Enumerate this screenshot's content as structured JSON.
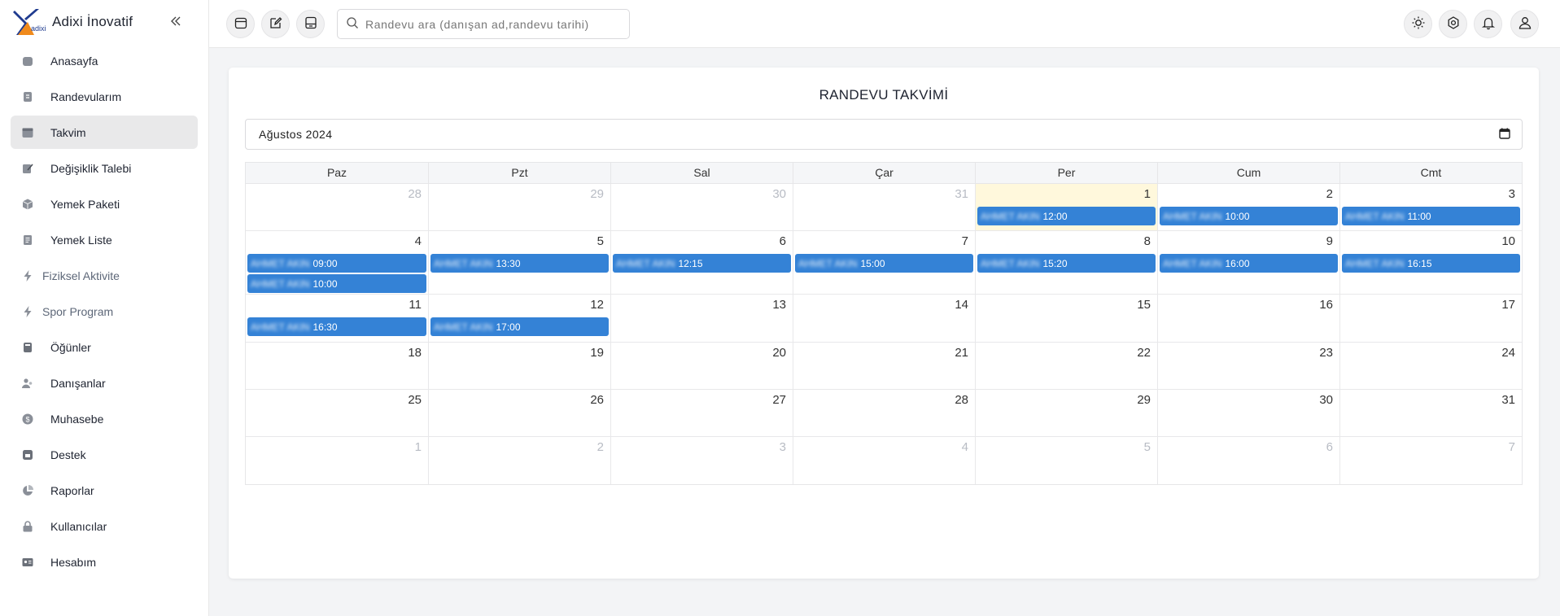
{
  "brand": {
    "title": "Adixi İnovatif",
    "logo_text": "adixi"
  },
  "sidebar": {
    "items": [
      {
        "label": "Anasayfa",
        "icon": "home-icon",
        "active": false,
        "muted": false
      },
      {
        "label": "Randevularım",
        "icon": "appointment-icon",
        "active": false,
        "muted": false
      },
      {
        "label": "Takvim",
        "icon": "calendar-icon",
        "active": true,
        "muted": false
      },
      {
        "label": "Değişiklik Talebi",
        "icon": "edit-icon",
        "active": false,
        "muted": false
      },
      {
        "label": "Yemek Paketi",
        "icon": "package-icon",
        "active": false,
        "muted": false
      },
      {
        "label": "Yemek Liste",
        "icon": "list-icon",
        "active": false,
        "muted": false
      },
      {
        "label": "Fiziksel Aktivite",
        "icon": "bolt-icon",
        "active": false,
        "muted": true
      },
      {
        "label": "Spor Program",
        "icon": "bolt-icon",
        "active": false,
        "muted": true
      },
      {
        "label": "Öğünler",
        "icon": "meals-icon",
        "active": false,
        "muted": false
      },
      {
        "label": "Danışanlar",
        "icon": "users-icon",
        "active": false,
        "muted": false
      },
      {
        "label": "Muhasebe",
        "icon": "dollar-icon",
        "active": false,
        "muted": false
      },
      {
        "label": "Destek",
        "icon": "support-icon",
        "active": false,
        "muted": false
      },
      {
        "label": "Raporlar",
        "icon": "pie-chart-icon",
        "active": false,
        "muted": false
      },
      {
        "label": "Kullanıcılar",
        "icon": "lock-icon",
        "active": false,
        "muted": false
      },
      {
        "label": "Hesabım",
        "icon": "id-card-icon",
        "active": false,
        "muted": false
      }
    ]
  },
  "search": {
    "placeholder": "Randevu ara (danışan ad,randevu tarihi)"
  },
  "calendar": {
    "title": "RANDEVU TAKVİMİ",
    "month_value": "Ağustos 2024",
    "weekdays": [
      "Paz",
      "Pzt",
      "Sal",
      "Çar",
      "Per",
      "Cum",
      "Cmt"
    ],
    "weeks": [
      [
        {
          "day": "28",
          "other": true,
          "events": []
        },
        {
          "day": "29",
          "other": true,
          "events": []
        },
        {
          "day": "30",
          "other": true,
          "events": []
        },
        {
          "day": "31",
          "other": true,
          "events": []
        },
        {
          "day": "1",
          "today": true,
          "events": [
            {
              "name": "AHMET AKIN",
              "time": "12:00"
            }
          ]
        },
        {
          "day": "2",
          "events": [
            {
              "name": "AHMET AKIN",
              "time": "10:00"
            }
          ]
        },
        {
          "day": "3",
          "events": [
            {
              "name": "AHMET AKIN",
              "time": "11:00"
            }
          ]
        }
      ],
      [
        {
          "day": "4",
          "events": [
            {
              "name": "AHMET AKIN",
              "time": "09:00"
            },
            {
              "name": "AHMET AKIN",
              "time": "10:00"
            }
          ]
        },
        {
          "day": "5",
          "events": [
            {
              "name": "AHMET AKIN",
              "time": "13:30"
            }
          ]
        },
        {
          "day": "6",
          "events": [
            {
              "name": "AHMET AKIN",
              "time": "12:15"
            }
          ]
        },
        {
          "day": "7",
          "events": [
            {
              "name": "AHMET AKIN",
              "time": "15:00"
            }
          ]
        },
        {
          "day": "8",
          "events": [
            {
              "name": "AHMET AKIN",
              "time": "15:20"
            }
          ]
        },
        {
          "day": "9",
          "events": [
            {
              "name": "AHMET AKIN",
              "time": "16:00"
            }
          ]
        },
        {
          "day": "10",
          "events": [
            {
              "name": "AHMET AKIN",
              "time": "16:15"
            }
          ]
        }
      ],
      [
        {
          "day": "11",
          "events": [
            {
              "name": "AHMET AKIN",
              "time": "16:30"
            }
          ]
        },
        {
          "day": "12",
          "events": [
            {
              "name": "AHMET AKIN",
              "time": "17:00"
            }
          ]
        },
        {
          "day": "13",
          "events": []
        },
        {
          "day": "14",
          "events": []
        },
        {
          "day": "15",
          "events": []
        },
        {
          "day": "16",
          "events": []
        },
        {
          "day": "17",
          "events": []
        }
      ],
      [
        {
          "day": "18",
          "events": []
        },
        {
          "day": "19",
          "events": []
        },
        {
          "day": "20",
          "events": []
        },
        {
          "day": "21",
          "events": []
        },
        {
          "day": "22",
          "events": []
        },
        {
          "day": "23",
          "events": []
        },
        {
          "day": "24",
          "events": []
        }
      ],
      [
        {
          "day": "25",
          "events": []
        },
        {
          "day": "26",
          "events": []
        },
        {
          "day": "27",
          "events": []
        },
        {
          "day": "28",
          "events": []
        },
        {
          "day": "29",
          "events": []
        },
        {
          "day": "30",
          "events": []
        },
        {
          "day": "31",
          "events": []
        }
      ],
      [
        {
          "day": "1",
          "other": true,
          "events": []
        },
        {
          "day": "2",
          "other": true,
          "events": []
        },
        {
          "day": "3",
          "other": true,
          "events": []
        },
        {
          "day": "4",
          "other": true,
          "events": []
        },
        {
          "day": "5",
          "other": true,
          "events": []
        },
        {
          "day": "6",
          "other": true,
          "events": []
        },
        {
          "day": "7",
          "other": true,
          "events": []
        }
      ]
    ]
  },
  "colors": {
    "event": "#3482d6",
    "today": "#fff8dc",
    "active_nav": "#e9e9ea"
  }
}
